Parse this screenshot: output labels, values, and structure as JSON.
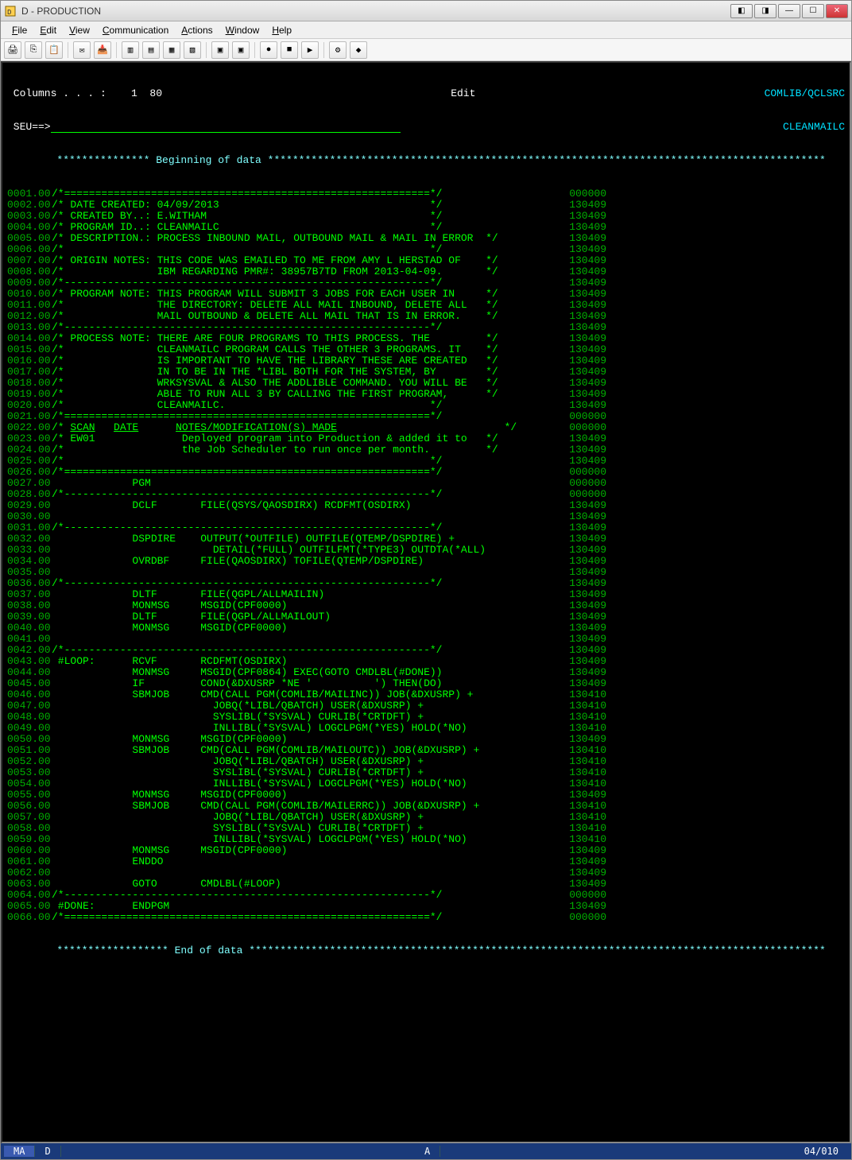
{
  "window": {
    "title": "D - PRODUCTION"
  },
  "menu": {
    "file": "File",
    "edit": "Edit",
    "view": "View",
    "communication": "Communication",
    "actions": "Actions",
    "window": "Window",
    "help": "Help"
  },
  "header": {
    "columns_label": " Columns . . . :    1  80",
    "mode": "Edit",
    "lib": "COMLIB/QCLSRC",
    "seu_label": " SEU==>",
    "member": "CLEANMAILC",
    "begin_banner": "        *************** Beginning of data ******************************************************************************************",
    "end_banner": "        ****************** End of data *********************************************************************************************"
  },
  "lines": [
    {
      "seq": "0001.00",
      "text": "/*===========================================================*/",
      "date": "000000"
    },
    {
      "seq": "0002.00",
      "text": "/* DATE CREATED: 04/09/2013                                  */",
      "date": "130409"
    },
    {
      "seq": "0003.00",
      "text": "/* CREATED BY..: E.WITHAM                                    */",
      "date": "130409"
    },
    {
      "seq": "0004.00",
      "text": "/* PROGRAM ID..: CLEANMAILC                                  */",
      "date": "130409"
    },
    {
      "seq": "0005.00",
      "text": "/* DESCRIPTION.: PROCESS INBOUND MAIL, OUTBOUND MAIL & MAIL IN ERROR  */",
      "date": "130409"
    },
    {
      "seq": "0006.00",
      "text": "/*                                                           */",
      "date": "130409"
    },
    {
      "seq": "0007.00",
      "text": "/* ORIGIN NOTES: THIS CODE WAS EMAILED TO ME FROM AMY L HERSTAD OF    */",
      "date": "130409"
    },
    {
      "seq": "0008.00",
      "text": "/*               IBM REGARDING PMR#: 38957B7TD FROM 2013-04-09.       */",
      "date": "130409"
    },
    {
      "seq": "0009.00",
      "text": "/*-----------------------------------------------------------*/",
      "date": "130409"
    },
    {
      "seq": "0010.00",
      "text": "/* PROGRAM NOTE: THIS PROGRAM WILL SUBMIT 3 JOBS FOR EACH USER IN     */",
      "date": "130409"
    },
    {
      "seq": "0011.00",
      "text": "/*               THE DIRECTORY: DELETE ALL MAIL INBOUND, DELETE ALL   */",
      "date": "130409"
    },
    {
      "seq": "0012.00",
      "text": "/*               MAIL OUTBOUND & DELETE ALL MAIL THAT IS IN ERROR.    */",
      "date": "130409"
    },
    {
      "seq": "0013.00",
      "text": "/*-----------------------------------------------------------*/",
      "date": "130409"
    },
    {
      "seq": "0014.00",
      "text": "/* PROCESS NOTE: THERE ARE FOUR PROGRAMS TO THIS PROCESS. THE         */",
      "date": "130409"
    },
    {
      "seq": "0015.00",
      "text": "/*               CLEANMAILC PROGRAM CALLS THE OTHER 3 PROGRAMS. IT    */",
      "date": "130409"
    },
    {
      "seq": "0016.00",
      "text": "/*               IS IMPORTANT TO HAVE THE LIBRARY THESE ARE CREATED   */",
      "date": "130409"
    },
    {
      "seq": "0017.00",
      "text": "/*               IN TO BE IN THE *LIBL BOTH FOR THE SYSTEM, BY        */",
      "date": "130409"
    },
    {
      "seq": "0018.00",
      "text": "/*               WRKSYSVAL & ALSO THE ADDLIBLE COMMAND. YOU WILL BE   */",
      "date": "130409"
    },
    {
      "seq": "0019.00",
      "text": "/*               ABLE TO RUN ALL 3 BY CALLING THE FIRST PROGRAM,      */",
      "date": "130409"
    },
    {
      "seq": "0020.00",
      "text": "/*               CLEANMAILC.                                 */",
      "date": "130409"
    },
    {
      "seq": "0021.00",
      "text": "/*===========================================================*/",
      "date": "000000"
    },
    {
      "seq": "0022.00",
      "text": "/* ",
      "scan": "SCAN",
      "dcol": "DATE",
      "notes": "NOTES/MODIFICATION(S) MADE",
      "tail": "                           */",
      "date": "000000",
      "underline": true
    },
    {
      "seq": "0023.00",
      "text": "/* EW01              Deployed program into Production & added it to   */",
      "date": "130409"
    },
    {
      "seq": "0024.00",
      "text": "/*                   the Job Scheduler to run once per month.         */",
      "date": "130409"
    },
    {
      "seq": "0025.00",
      "text": "/*                                                           */",
      "date": "130409"
    },
    {
      "seq": "0026.00",
      "text": "/*===========================================================*/",
      "date": "000000"
    },
    {
      "seq": "0027.00",
      "text": "             PGM",
      "date": "000000"
    },
    {
      "seq": "0028.00",
      "text": "/*-----------------------------------------------------------*/",
      "date": "000000"
    },
    {
      "seq": "0029.00",
      "text": "             DCLF       FILE(QSYS/QAOSDIRX) RCDFMT(OSDIRX)",
      "date": "130409"
    },
    {
      "seq": "0030.00",
      "text": "",
      "date": "130409"
    },
    {
      "seq": "0031.00",
      "text": "/*-----------------------------------------------------------*/",
      "date": "130409"
    },
    {
      "seq": "0032.00",
      "text": "             DSPDIRE    OUTPUT(*OUTFILE) OUTFILE(QTEMP/DSPDIRE) +",
      "date": "130409"
    },
    {
      "seq": "0033.00",
      "text": "                          DETAIL(*FULL) OUTFILFMT(*TYPE3) OUTDTA(*ALL)",
      "date": "130409"
    },
    {
      "seq": "0034.00",
      "text": "             OVRDBF     FILE(QAOSDIRX) TOFILE(QTEMP/DSPDIRE)",
      "date": "130409"
    },
    {
      "seq": "0035.00",
      "text": "",
      "date": "130409"
    },
    {
      "seq": "0036.00",
      "text": "/*-----------------------------------------------------------*/",
      "date": "130409"
    },
    {
      "seq": "0037.00",
      "text": "             DLTF       FILE(QGPL/ALLMAILIN)",
      "date": "130409"
    },
    {
      "seq": "0038.00",
      "text": "             MONMSG     MSGID(CPF0000)",
      "date": "130409"
    },
    {
      "seq": "0039.00",
      "text": "             DLTF       FILE(QGPL/ALLMAILOUT)",
      "date": "130409"
    },
    {
      "seq": "0040.00",
      "text": "             MONMSG     MSGID(CPF0000)",
      "date": "130409"
    },
    {
      "seq": "0041.00",
      "text": "",
      "date": "130409"
    },
    {
      "seq": "0042.00",
      "text": "/*-----------------------------------------------------------*/",
      "date": "130409"
    },
    {
      "seq": "0043.00",
      "text": " #LOOP:      RCVF       RCDFMT(OSDIRX)",
      "date": "130409"
    },
    {
      "seq": "0044.00",
      "text": "             MONMSG     MSGID(CPF0864) EXEC(GOTO CMDLBL(#DONE))",
      "date": "130409"
    },
    {
      "seq": "0045.00",
      "text": "             IF         COND(&DXUSRP *NE '          ') THEN(DO)",
      "date": "130409"
    },
    {
      "seq": "0046.00",
      "text": "             SBMJOB     CMD(CALL PGM(COMLIB/MAILINC)) JOB(&DXUSRP) +",
      "date": "130410"
    },
    {
      "seq": "0047.00",
      "text": "                          JOBQ(*LIBL/QBATCH) USER(&DXUSRP) +",
      "date": "130410"
    },
    {
      "seq": "0048.00",
      "text": "                          SYSLIBL(*SYSVAL) CURLIB(*CRTDFT) +",
      "date": "130410"
    },
    {
      "seq": "0049.00",
      "text": "                          INLLIBL(*SYSVAL) LOGCLPGM(*YES) HOLD(*NO)",
      "date": "130410"
    },
    {
      "seq": "0050.00",
      "text": "             MONMSG     MSGID(CPF0000)",
      "date": "130409"
    },
    {
      "seq": "0051.00",
      "text": "             SBMJOB     CMD(CALL PGM(COMLIB/MAILOUTC)) JOB(&DXUSRP) +",
      "date": "130410"
    },
    {
      "seq": "0052.00",
      "text": "                          JOBQ(*LIBL/QBATCH) USER(&DXUSRP) +",
      "date": "130410"
    },
    {
      "seq": "0053.00",
      "text": "                          SYSLIBL(*SYSVAL) CURLIB(*CRTDFT) +",
      "date": "130410"
    },
    {
      "seq": "0054.00",
      "text": "                          INLLIBL(*SYSVAL) LOGCLPGM(*YES) HOLD(*NO)",
      "date": "130410"
    },
    {
      "seq": "0055.00",
      "text": "             MONMSG     MSGID(CPF0000)",
      "date": "130409"
    },
    {
      "seq": "0056.00",
      "text": "             SBMJOB     CMD(CALL PGM(COMLIB/MAILERRC)) JOB(&DXUSRP) +",
      "date": "130410"
    },
    {
      "seq": "0057.00",
      "text": "                          JOBQ(*LIBL/QBATCH) USER(&DXUSRP) +",
      "date": "130410"
    },
    {
      "seq": "0058.00",
      "text": "                          SYSLIBL(*SYSVAL) CURLIB(*CRTDFT) +",
      "date": "130410"
    },
    {
      "seq": "0059.00",
      "text": "                          INLLIBL(*SYSVAL) LOGCLPGM(*YES) HOLD(*NO)",
      "date": "130410"
    },
    {
      "seq": "0060.00",
      "text": "             MONMSG     MSGID(CPF0000)",
      "date": "130409"
    },
    {
      "seq": "0061.00",
      "text": "             ENDDO",
      "date": "130409"
    },
    {
      "seq": "0062.00",
      "text": "",
      "date": "130409"
    },
    {
      "seq": "0063.00",
      "text": "             GOTO       CMDLBL(#LOOP)",
      "date": "130409"
    },
    {
      "seq": "0064.00",
      "text": "/*-----------------------------------------------------------*/",
      "date": "000000"
    },
    {
      "seq": "0065.00",
      "text": " #DONE:      ENDPGM",
      "date": "130409"
    },
    {
      "seq": "0066.00",
      "text": "/*===========================================================*/",
      "date": "000000"
    }
  ],
  "status": {
    "left1": "MA",
    "left2": "D",
    "mid": "A",
    "pos": "04/010"
  }
}
